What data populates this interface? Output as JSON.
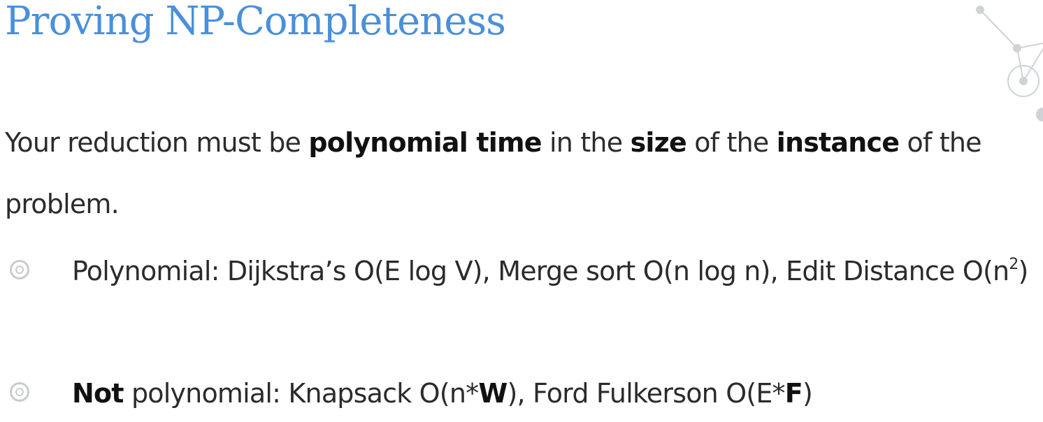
{
  "slide": {
    "title": "Proving NP-Completeness",
    "intro": {
      "t1": "Your reduction must be ",
      "b1": "polynomial time",
      "t2": " in the ",
      "b2": "size",
      "t3": " of the ",
      "b3": "instance",
      "t4": " of the problem."
    },
    "bullets": [
      {
        "text": "Polynomial: Dijkstra’s O(E log V), Merge sort O(n log n), Edit Distance O(n",
        "sup": "2",
        "tail": ")"
      },
      {
        "bold_not": "Not",
        "t1": " polynomial: Knapsack O(n*",
        "b1": "W",
        "t2": "), Ford Fulkerson O(E*",
        "b2": "F",
        "t3": ")"
      }
    ]
  },
  "colors": {
    "title": "#4a90d9",
    "text": "#2b2b2b",
    "bullet_marker": "#c9cbcd",
    "decoration": "#cfd3d6"
  },
  "icons": {
    "bullet": "double-circle-bullet-icon",
    "decoration": "network-graph-decoration-icon"
  }
}
